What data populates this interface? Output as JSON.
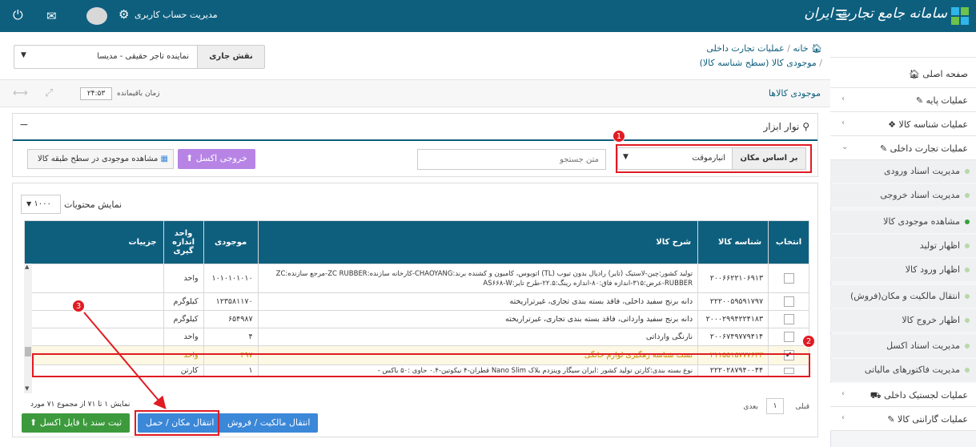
{
  "topbar": {
    "brand": "سامانه جامع تجارت ایران",
    "account": "مدیریت حساب کاربری"
  },
  "sidebar": {
    "items": [
      {
        "label": "صفحه اصلی",
        "icon": "home-icon"
      },
      {
        "label": "عملیات پایه",
        "icon": "edit-icon"
      },
      {
        "label": "عملیات شناسه کالا",
        "icon": "cubes-icon"
      },
      {
        "label": "عملیات تجارت داخلی",
        "icon": "edit-icon"
      }
    ],
    "sub": [
      "مدیریت اسناد ورودی",
      "مدیریت اسناد خروجی",
      "مشاهده موجودی کالا",
      "اظهار تولید",
      "اظهار ورود کالا",
      "انتقال مالکیت و مکان(فروش)",
      "اظهار خروج کالا",
      "مدیریت اسناد اکسل",
      "مدیریت فاکتورهای مالیاتی"
    ],
    "bottom": [
      {
        "label": "عملیات لجستیک داخلی",
        "icon": "truck-icon"
      },
      {
        "label": "عملیات گارانتی کالا",
        "icon": "edit-icon"
      }
    ]
  },
  "breadcrumb": {
    "home": "خانه",
    "sep": "/",
    "level1": "عملیات تجارت داخلی",
    "level2": "موجودی کالا (سطح شناسه کالا)"
  },
  "role": {
    "label": "نقش جاری",
    "value": "نماینده تاجر حقیقی - مدیسا"
  },
  "page_title": "موجودی کالاها",
  "timer": {
    "label": "زمان باقیمانده",
    "value": "۲۴:۵۳"
  },
  "toolbar": {
    "title": "نوار ابزار",
    "filter_label": "بر اساس مکان",
    "filter_value": "انبارموقت",
    "search_placeholder": "متن جستجو",
    "export_excel": "خروجی اکسل",
    "view_class": "مشاهده موجودی در سطح طبقه کالا"
  },
  "table": {
    "show_label": "نمایش محتویات",
    "show_value": "۱۰۰۰",
    "headers": [
      "انتخاب",
      "شناسه کالا",
      "شرح کالا",
      "موجودی",
      "واحد اندازه گیری",
      "جزییات"
    ],
    "rows": [
      {
        "id": "۲۰۰۶۶۲۲۱۰۶۹۱۳",
        "desc": "تولید کشور:چین-لاستیک (تایر) رادیال بدون تیوب (TL) اتوبوس، کامیون و کشنده برند:CHAOYANG-کارخانه سازنده:ZC RUBBER-مرجع سازنده:ZC RUBBER-عرض:۳۱۵-اندازه فاق:۸۰-اندازه رینگ:۲۲.۵-طرح تایر:AS۶۶۸-W",
        "stock": "۱۰۱۰۱۰۱۰۱۰",
        "unit": "واحد"
      },
      {
        "id": "۲۲۲۰۰۵۹۵۹۱۷۹۷",
        "desc": "دانه برنج سفید داخلی، فاقد بسته بندی تجاری، غیرتراریخته",
        "stock": "۱۲۳۵۸۱۱۷۰",
        "unit": "کیلوگرم"
      },
      {
        "id": "۲۰۰۰۲۹۹۴۲۲۴۱۸۳",
        "desc": "دانه برنج سفید وارداتی، فاقد بسته بندی تجاری، غیرتراریخته",
        "stock": "۶۵۴۹۸۷",
        "unit": "کیلوگرم"
      },
      {
        "id": "۲۰۰۶۷۴۹۷۷۹۴۱۴",
        "desc": "نارنگی وارداتی",
        "stock": "۴",
        "unit": "واحد"
      },
      {
        "id": "۲۱۱۵۵۱۵۷۷۷۶۳۳",
        "desc": "تست شناسه رهگیری لوازم خانگی",
        "stock": "۴۹۷",
        "unit": "واحد"
      },
      {
        "id": "۲۲۲۰۲۸۷۹۴۰۰۴۴",
        "desc": "نوع بسته بندی:کارتن تولید کشور :ایران سیگار وینزدم بلاک Nano Slim قطران-۴ نیکوتین-۰.۴ حاوی :۵۰ باکس -",
        "stock": "۱",
        "unit": "کارتن"
      }
    ],
    "footer": "نمایش ۱ تا ۷۱ از مجموع ۷۱ مورد",
    "prev": "قبلی",
    "page": "۱",
    "next": "بعدی"
  },
  "actions": {
    "transfer_own": "انتقال مالکیت / فروش",
    "transfer_loc": "انتقال مکان / حمل",
    "excel_doc": "ثبت سند با فایل اکسل"
  },
  "badges": [
    "1",
    "2",
    "3"
  ],
  "colors": {
    "primary": "#0e5f7e",
    "purple": "#b784e6",
    "blue": "#3b87d8",
    "green": "#3c9a3c",
    "red": "#e01b22"
  }
}
